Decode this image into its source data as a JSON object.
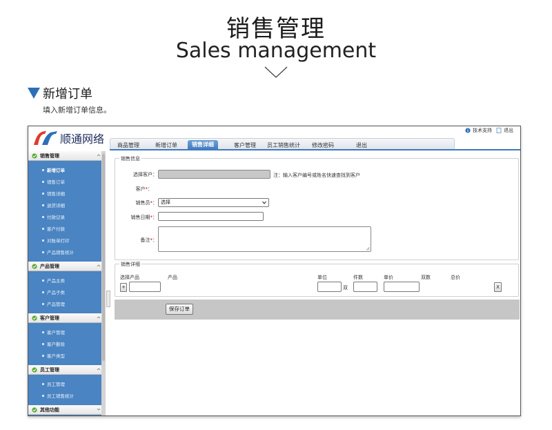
{
  "hero": {
    "title": "销售管理",
    "subtitle": "Sales management",
    "chevron_icon": "chevron-down-icon"
  },
  "section": {
    "title": "新增订单",
    "description": "填入新增订单信息。",
    "accent_color": "#2c6fb8"
  },
  "app": {
    "brand": "顺通网络",
    "top_links": [
      {
        "label": "技术支持",
        "icon": "info-icon"
      },
      {
        "label": "退出",
        "icon": "document-icon"
      }
    ],
    "nav_tabs": [
      {
        "label": "商品管理",
        "active": false
      },
      {
        "label": "新增订单",
        "active": false
      },
      {
        "label": "销售详细",
        "active": true
      },
      {
        "label": "客户管理",
        "active": false
      },
      {
        "label": "员工销售统计",
        "active": false
      },
      {
        "label": "修改密码",
        "active": false
      },
      {
        "label": "退出",
        "active": false
      }
    ],
    "sidebar": {
      "groups": [
        {
          "title": "销售管理",
          "items": [
            "新增订单",
            "销售订单",
            "销售详细",
            "退货详细",
            "付款记录",
            "客户付款",
            "对账单打印",
            "产品销售统计"
          ],
          "active_item": "新增订单"
        },
        {
          "title": "产品管理",
          "items": [
            "产品主类",
            "产品子类",
            "产品管理"
          ]
        },
        {
          "title": "客户管理",
          "items": [
            "客户管理",
            "客户删除",
            "客户类型"
          ]
        },
        {
          "title": "员工管理",
          "items": [
            "员工管理",
            "员工销售统计"
          ]
        },
        {
          "title": "其他功能",
          "items": []
        }
      ]
    },
    "form": {
      "sales_info_legend": "销售信息",
      "select_customer_label": "选择客户",
      "select_customer_note": "注：输入客户编号或姓名快速查找到客户",
      "customer_label": "客户",
      "salesperson_label": "销售员",
      "salesperson_value": "选择",
      "sale_date_label": "销售日期",
      "remarks_label": "备注",
      "required_mark": "*",
      "colon": "：",
      "sales_detail_legend": "销售详细",
      "columns": {
        "select_product": "选择产品",
        "product": "产品",
        "unit": "单位",
        "pieces": "件数",
        "unit_price": "单价",
        "pairs": "双数",
        "total_price": "总价"
      },
      "pair_unit": "双",
      "add_button": "+",
      "remove_button": "X",
      "save_button": "保存订单"
    }
  },
  "colors": {
    "sidebar_bg": "#4a84c2",
    "active_tab": "#3d78bd",
    "bottom_bar": "#c6c6c6"
  }
}
